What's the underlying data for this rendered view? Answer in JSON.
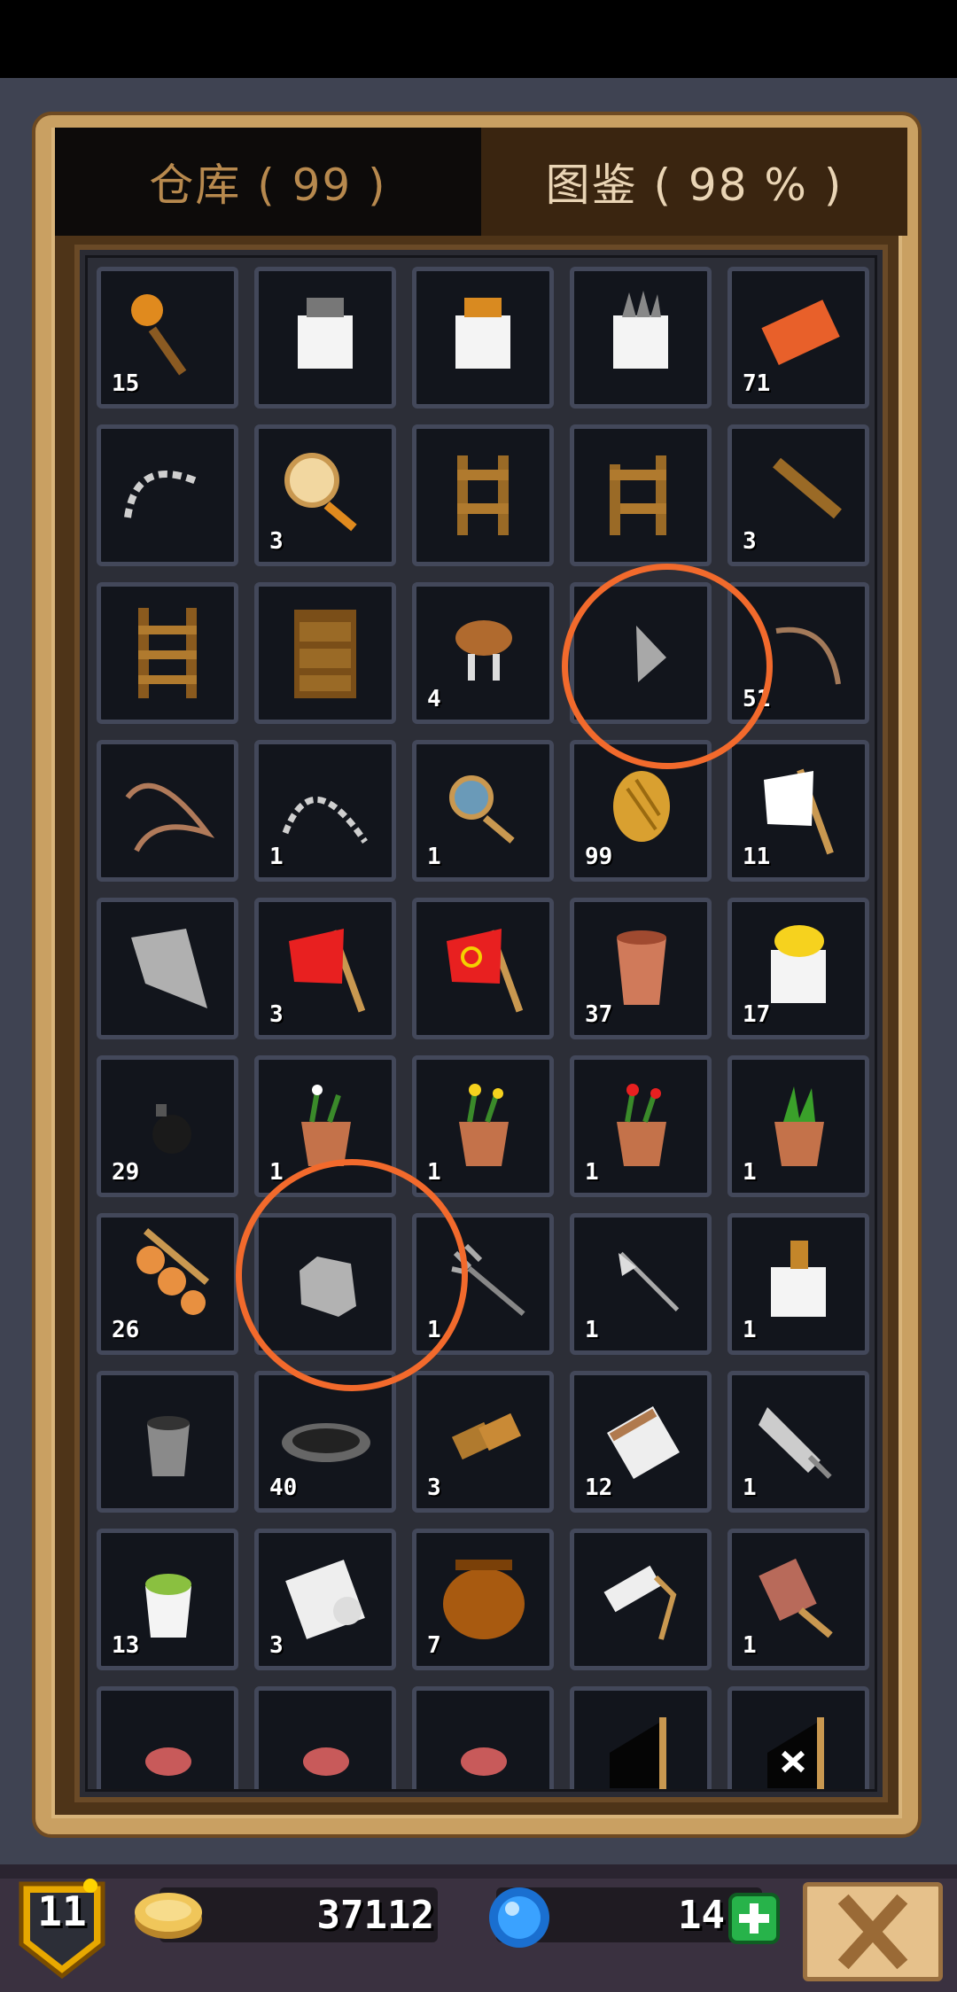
{
  "tabs": {
    "storage": "仓库 ( 99 )",
    "catalog": "图鉴 ( 98 % )"
  },
  "items": [
    {
      "icon": "torch-icon",
      "count": "15"
    },
    {
      "icon": "pelt-gray-icon",
      "count": ""
    },
    {
      "icon": "pelt-orange-icon",
      "count": ""
    },
    {
      "icon": "pelt-spiky-icon",
      "count": ""
    },
    {
      "icon": "brick-icon",
      "count": "71"
    },
    {
      "icon": "chain-icon",
      "count": ""
    },
    {
      "icon": "magnifier-gold-icon",
      "count": "3"
    },
    {
      "icon": "wooden-frame-icon",
      "count": ""
    },
    {
      "icon": "wooden-frame-broken-icon",
      "count": ""
    },
    {
      "icon": "wooden-plank-icon",
      "count": "3"
    },
    {
      "icon": "wooden-ladder-icon",
      "count": ""
    },
    {
      "icon": "wooden-shelf-icon",
      "count": ""
    },
    {
      "icon": "stool-icon",
      "count": "4"
    },
    {
      "icon": "gray-shard-icon",
      "count": ""
    },
    {
      "icon": "rope-icon",
      "count": "51"
    },
    {
      "icon": "whip-icon",
      "count": ""
    },
    {
      "icon": "chain-whip-icon",
      "count": "1"
    },
    {
      "icon": "magnifier-blue-icon",
      "count": "1"
    },
    {
      "icon": "straw-icon",
      "count": "99"
    },
    {
      "icon": "flag-white-icon",
      "count": "11"
    },
    {
      "icon": "flag-gray-icon",
      "count": ""
    },
    {
      "icon": "flag-red-icon",
      "count": "3"
    },
    {
      "icon": "flag-hammer-sickle-icon",
      "count": ""
    },
    {
      "icon": "clay-pot-icon",
      "count": "37"
    },
    {
      "icon": "pelt-yellow-icon",
      "count": "17"
    },
    {
      "icon": "bomb-icon",
      "count": "29"
    },
    {
      "icon": "flower-pot-white-icon",
      "count": "1"
    },
    {
      "icon": "flower-pot-yellow-icon",
      "count": "1"
    },
    {
      "icon": "flower-pot-red-icon",
      "count": "1"
    },
    {
      "icon": "flower-pot-green-icon",
      "count": "1"
    },
    {
      "icon": "meat-skewer-icon",
      "count": "26"
    },
    {
      "icon": "gray-stone-icon",
      "count": ""
    },
    {
      "icon": "trident-icon",
      "count": "1"
    },
    {
      "icon": "spear-icon",
      "count": "1"
    },
    {
      "icon": "pelt-bundle-icon",
      "count": "1"
    },
    {
      "icon": "bucket-icon",
      "count": ""
    },
    {
      "icon": "iron-pan-icon",
      "count": "40"
    },
    {
      "icon": "bread-icon",
      "count": "3"
    },
    {
      "icon": "paper-scroll-icon",
      "count": "12"
    },
    {
      "icon": "broom-icon",
      "count": "1"
    },
    {
      "icon": "bucket-green-icon",
      "count": "13"
    },
    {
      "icon": "cloth-roll-icon",
      "count": "3"
    },
    {
      "icon": "big-jar-icon",
      "count": "7"
    },
    {
      "icon": "paint-roller-icon",
      "count": ""
    },
    {
      "icon": "brush-icon",
      "count": "1"
    },
    {
      "icon": "meat-icon",
      "count": ""
    },
    {
      "icon": "meat-icon",
      "count": ""
    },
    {
      "icon": "meat-icon",
      "count": ""
    },
    {
      "icon": "flag-black-icon",
      "count": ""
    },
    {
      "icon": "flag-pirate-icon",
      "count": ""
    }
  ],
  "footer": {
    "level": "11",
    "coins": "37112",
    "gems": "14"
  },
  "colors": {
    "annotation": "#f26a2c",
    "slot_border": "#43485a",
    "gold": "#c9a062"
  }
}
